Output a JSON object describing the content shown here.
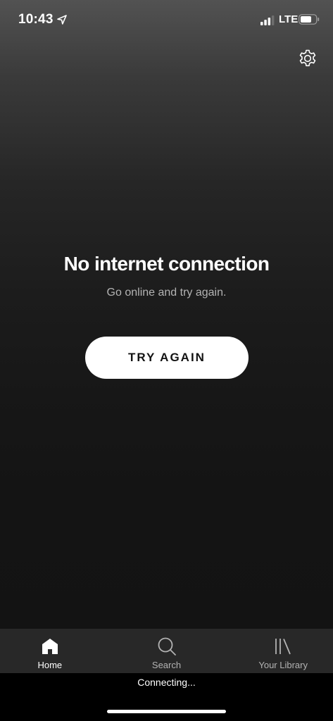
{
  "status_bar": {
    "time": "10:43",
    "network": "LTE",
    "location_icon": "location-arrow-icon",
    "signal_icon": "cellular-signal-icon",
    "battery_icon": "battery-icon"
  },
  "header": {
    "settings_icon": "gear-icon"
  },
  "message": {
    "title": "No internet connection",
    "subtitle": "Go online and try again.",
    "button_label": "TRY AGAIN"
  },
  "bottom_nav": {
    "items": [
      {
        "label": "Home",
        "icon": "home-icon",
        "active": true
      },
      {
        "label": "Search",
        "icon": "search-icon",
        "active": false
      },
      {
        "label": "Your Library",
        "icon": "library-icon",
        "active": false
      }
    ]
  },
  "footer": {
    "status_text": "Connecting..."
  },
  "colors": {
    "background": "#121212",
    "nav_background": "#282828",
    "button_background": "#ffffff",
    "secondary_text": "#b3b3b3"
  }
}
